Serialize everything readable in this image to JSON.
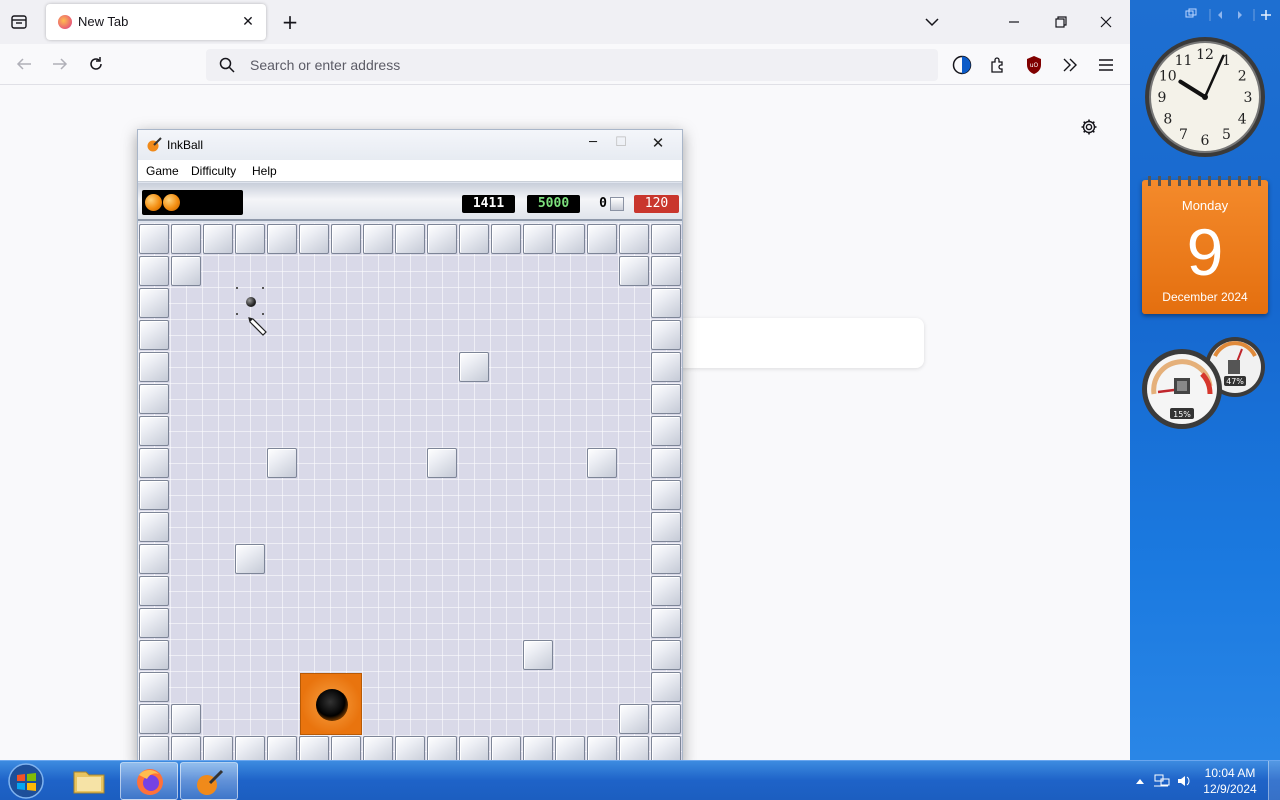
{
  "browser": {
    "tab_title": "New Tab",
    "url_placeholder": "Search or enter address"
  },
  "inkball": {
    "title": "InkBall",
    "menu": [
      "Game",
      "Difficulty",
      "Help"
    ],
    "score": "1411",
    "target": "5000",
    "balls_lost": "0",
    "timer": "120",
    "balls_remaining": 2,
    "colors": {
      "goal": "#e9740e",
      "timer_bg": "#c9362d",
      "target_text": "#7de07d"
    }
  },
  "calendar": {
    "day": "Monday",
    "date": "9",
    "month": "December 2024"
  },
  "meters": {
    "cpu": "15%",
    "memory": "47%"
  },
  "clock": {
    "hour": 10,
    "minute": 4
  },
  "taskbar": {
    "time": "10:04 AM",
    "date": "12/9/2024"
  }
}
